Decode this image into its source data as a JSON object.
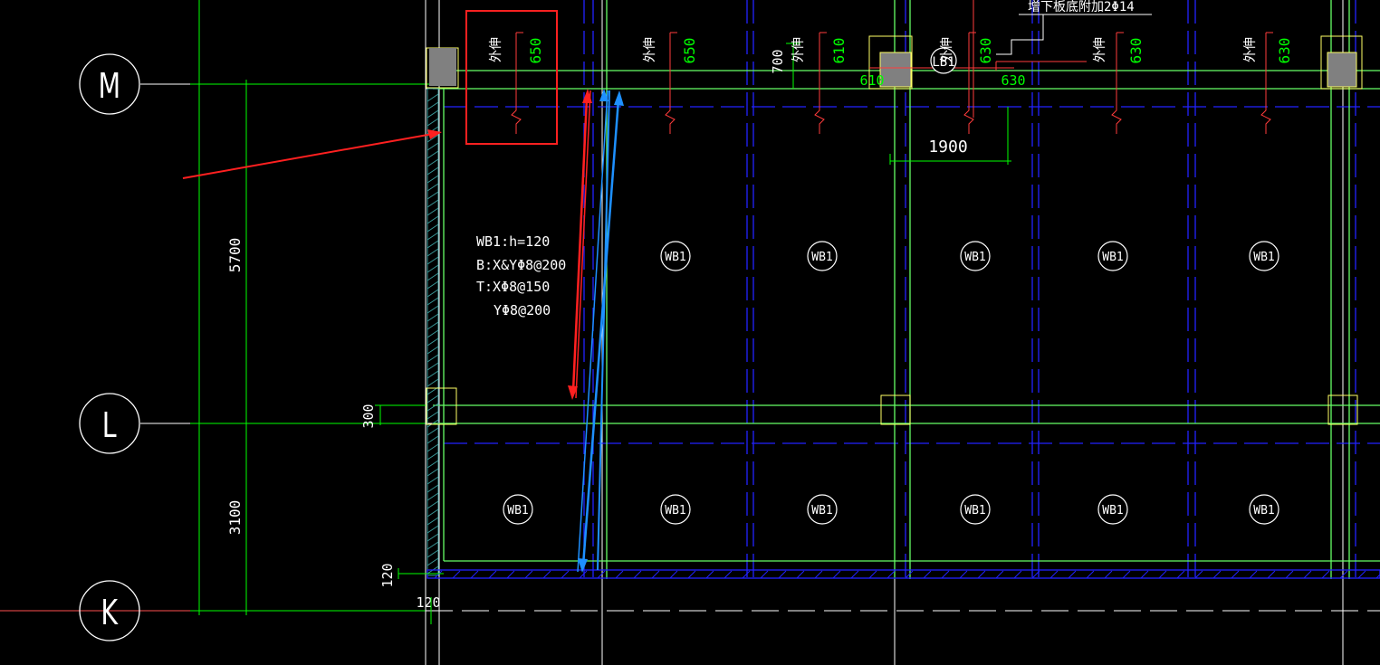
{
  "axes": {
    "M": "M",
    "L": "L",
    "K": "K"
  },
  "dimensions": {
    "d5700": "5700",
    "d3100": "3100",
    "d300": "300",
    "d120v": "120",
    "d120h": "120",
    "d700": "700",
    "d1900": "1900"
  },
  "slab_note": {
    "line1": "WB1:h=120",
    "line2": "B:X&YΦ8@200",
    "line3": "T:XΦ8@150",
    "line4": "YΦ8@200"
  },
  "top_note": "增下板底附加2Φ14",
  "beam_label": "LB1",
  "slab_tag": "WB1",
  "rebar": {
    "label": "外伸",
    "v650": "650",
    "v610": "610",
    "v630": "630"
  },
  "colors": {
    "background": "#000000",
    "grid_green": "#00ff00",
    "beam_line": "#7fff7f",
    "dashed_blue": "#2020ff",
    "rebar_red": "#ff3b3b",
    "text_white": "#ffffff",
    "highlight_red": "#ff2020",
    "arrow_blue": "#1e90ff",
    "column_gray": "#808080",
    "column_outline": "#ffff66"
  }
}
